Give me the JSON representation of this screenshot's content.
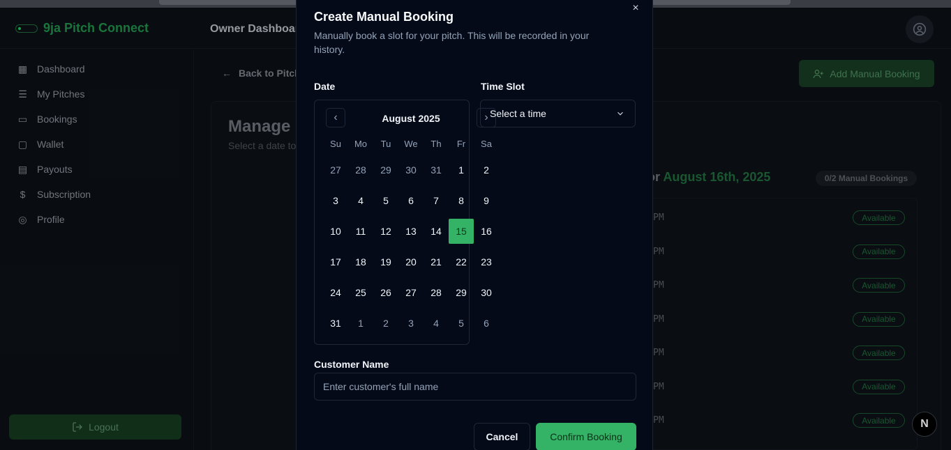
{
  "app": {
    "brand": "9ja Pitch Connect",
    "header_title": "Owner Dashboard"
  },
  "sidebar": {
    "items": [
      {
        "label": "Dashboard",
        "icon": "grid-icon"
      },
      {
        "label": "My Pitches",
        "icon": "list-icon"
      },
      {
        "label": "Bookings",
        "icon": "calendar-icon"
      },
      {
        "label": "Wallet",
        "icon": "wallet-icon"
      },
      {
        "label": "Payouts",
        "icon": "receipt-icon"
      },
      {
        "label": "Subscription",
        "icon": "dollar-icon"
      },
      {
        "label": "Profile",
        "icon": "user-circle-icon"
      }
    ],
    "logout": "Logout"
  },
  "main": {
    "back_link": "Back to Pitch",
    "add_button": "Add Manual Booking",
    "card_title": "Manage S",
    "card_subtitle": "Select a date to",
    "slots_title_prefix": "or ",
    "slots_title_date": "August 16th, 2025",
    "counter": "0/2 Manual Bookings",
    "slots": [
      {
        "time": "PM",
        "status": "Available"
      },
      {
        "time": "PM",
        "status": "Available"
      },
      {
        "time": "PM",
        "status": "Available"
      },
      {
        "time": "PM",
        "status": "Available"
      },
      {
        "time": "PM",
        "status": "Available"
      },
      {
        "time": "PM",
        "status": "Available"
      },
      {
        "time": "PM",
        "status": "Available"
      }
    ]
  },
  "fab": "N",
  "modal": {
    "title": "Create Manual Booking",
    "description": "Manually book a slot for your pitch. This will be recorded in your history.",
    "close": "×",
    "date_label": "Date",
    "time_label": "Time Slot",
    "time_placeholder": "Select a time",
    "customer_label": "Customer Name",
    "customer_placeholder": "Enter customer's full name",
    "cancel": "Cancel",
    "confirm": "Confirm Booking",
    "calendar": {
      "month": "August 2025",
      "weekdays": [
        "Su",
        "Mo",
        "Tu",
        "We",
        "Th",
        "Fr",
        "Sa"
      ],
      "weeks": [
        [
          "27",
          "28",
          "29",
          "30",
          "31",
          "1",
          "2"
        ],
        [
          "3",
          "4",
          "5",
          "6",
          "7",
          "8",
          "9"
        ],
        [
          "10",
          "11",
          "12",
          "13",
          "14",
          "15",
          "16"
        ],
        [
          "17",
          "18",
          "19",
          "20",
          "21",
          "22",
          "23"
        ],
        [
          "24",
          "25",
          "26",
          "27",
          "28",
          "29",
          "30"
        ],
        [
          "31",
          "1",
          "2",
          "3",
          "4",
          "5",
          "6"
        ]
      ],
      "outside": [
        [
          0,
          0
        ],
        [
          0,
          1
        ],
        [
          0,
          2
        ],
        [
          0,
          3
        ],
        [
          0,
          4
        ],
        [
          5,
          1
        ],
        [
          5,
          2
        ],
        [
          5,
          3
        ],
        [
          5,
          4
        ],
        [
          5,
          5
        ],
        [
          5,
          6
        ]
      ],
      "selected": [
        2,
        5
      ]
    }
  },
  "colors": {
    "accent": "#34b366",
    "modal_bg": "#050a18"
  }
}
